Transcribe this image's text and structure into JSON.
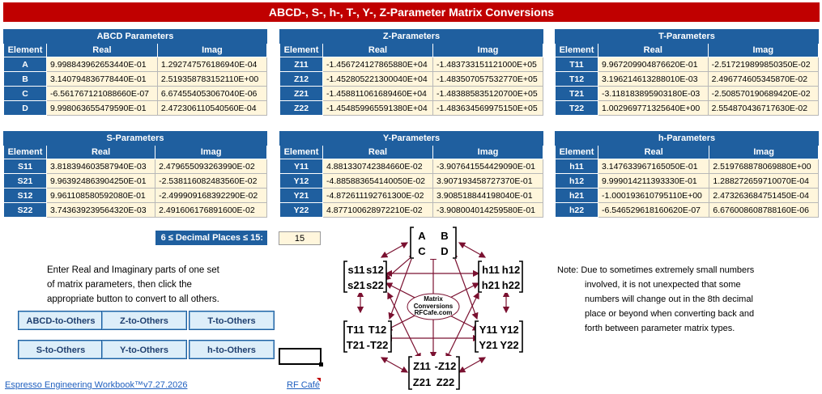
{
  "title": "ABCD-, S-, h-, T-, Y-, Z-Parameter Matrix Conversions",
  "col_headers": {
    "element": "Element",
    "real": "Real",
    "imag": "Imag"
  },
  "tables": {
    "abcd": {
      "caption": "ABCD Parameters",
      "rows": [
        {
          "el": "A",
          "real": "9.998843962653440E-01",
          "imag": "1.292747576186940E-04"
        },
        {
          "el": "B",
          "real": "3.140794836778440E-01",
          "imag": "2.519358783152110E+00"
        },
        {
          "el": "C",
          "real": "-6.561767121088660E-07",
          "imag": "6.674554053067040E-06"
        },
        {
          "el": "D",
          "real": "9.998063655479590E-01",
          "imag": "2.472306110540560E-04"
        }
      ]
    },
    "z": {
      "caption": "Z-Parameters",
      "rows": [
        {
          "el": "Z11",
          "real": "-1.456724127865880E+04",
          "imag": "-1.483733151121000E+05"
        },
        {
          "el": "Z12",
          "real": "-1.452805221300040E+04",
          "imag": "-1.483507057532770E+05"
        },
        {
          "el": "Z21",
          "real": "-1.458811061689460E+04",
          "imag": "-1.483885835120700E+05"
        },
        {
          "el": "Z22",
          "real": "-1.454859965591380E+04",
          "imag": "-1.483634569975150E+05"
        }
      ]
    },
    "t": {
      "caption": "T-Parameters",
      "rows": [
        {
          "el": "T11",
          "real": "9.967209904876620E-01",
          "imag": "-2.517219899850350E-02"
        },
        {
          "el": "T12",
          "real": "3.196214613288010E-03",
          "imag": "2.496774605345870E-02"
        },
        {
          "el": "T21",
          "real": "-3.118183895903180E-03",
          "imag": "-2.508570190689420E-02"
        },
        {
          "el": "T22",
          "real": "1.002969771325640E+00",
          "imag": "2.554870436717630E-02"
        }
      ]
    },
    "s": {
      "caption": "S-Parameters",
      "rows": [
        {
          "el": "S11",
          "real": "3.818394603587940E-03",
          "imag": "2.479655093263990E-02"
        },
        {
          "el": "S21",
          "real": "9.963924863904250E-01",
          "imag": "-2.538116082483560E-02"
        },
        {
          "el": "S12",
          "real": "9.961108580592080E-01",
          "imag": "-2.499909168392290E-02"
        },
        {
          "el": "S22",
          "real": "3.743639239564320E-03",
          "imag": "2.491606176891600E-02"
        }
      ]
    },
    "y": {
      "caption": "Y-Parameters",
      "rows": [
        {
          "el": "Y11",
          "real": "4.881330742384660E-02",
          "imag": "-3.907641554429090E-01"
        },
        {
          "el": "Y12",
          "real": "-4.885883654140050E-02",
          "imag": "3.907193458727370E-01"
        },
        {
          "el": "Y21",
          "real": "-4.872611192761300E-02",
          "imag": "3.908518844198040E-01"
        },
        {
          "el": "Y22",
          "real": "4.877100628972210E-02",
          "imag": "-3.908004014259580E-01"
        }
      ]
    },
    "h": {
      "caption": "h-Parameters",
      "rows": [
        {
          "el": "h11",
          "real": "3.147633967165050E-01",
          "imag": "2.519768878069880E+00"
        },
        {
          "el": "h12",
          "real": "9.999014211393330E-01",
          "imag": "1.288272659710070E-04"
        },
        {
          "el": "h21",
          "real": "-1.000193610795110E+00",
          "imag": "2.473263684751450E-04"
        },
        {
          "el": "h22",
          "real": "-6.546529618160620E-07",
          "imag": "6.676008608788160E-06"
        }
      ]
    }
  },
  "decimal": {
    "label": "6 ≤ Decimal Places ≤ 15:",
    "value": "15"
  },
  "instructions": [
    "Enter Real and Imaginary parts of one set",
    "of matrix parameters, then click the",
    "appropriate button to convert to all others."
  ],
  "buttons": [
    "ABCD-to-Others",
    "Z-to-Others",
    "T-to-Others",
    "S-to-Others",
    "Y-to-Others",
    "h-to-Others"
  ],
  "diagram": {
    "center": [
      "Matrix",
      "Conversions",
      "RFCafe.com"
    ],
    "abcd": [
      "A",
      "B",
      "C",
      "D"
    ],
    "s": [
      "s11",
      "s12",
      "s21",
      "s22"
    ],
    "h": [
      "h11",
      "h12",
      "h21",
      "h22"
    ],
    "t": [
      "T11",
      "T12",
      "T21",
      "-T22"
    ],
    "y": [
      "Y11",
      "Y12",
      "Y21",
      "Y22"
    ],
    "z": [
      "Z11",
      "-Z12",
      "Z21",
      "Z22"
    ]
  },
  "note": [
    "Note: Due to sometimes extremely small numbers",
    "involved, it is not unexpected that some",
    "numbers will change out in the 8th decimal",
    "place or beyond when converting back and",
    "forth between parameter matrix types."
  ],
  "footer": {
    "workbook": "Espresso Engineering Workbook™v7.27.2026",
    "rfcafe": "RF Café"
  },
  "colors": {
    "title_bg": "#c00000",
    "header_bg": "#1f5f9f",
    "cell_bg": "#fff6dc",
    "arrow": "#7a1030"
  }
}
